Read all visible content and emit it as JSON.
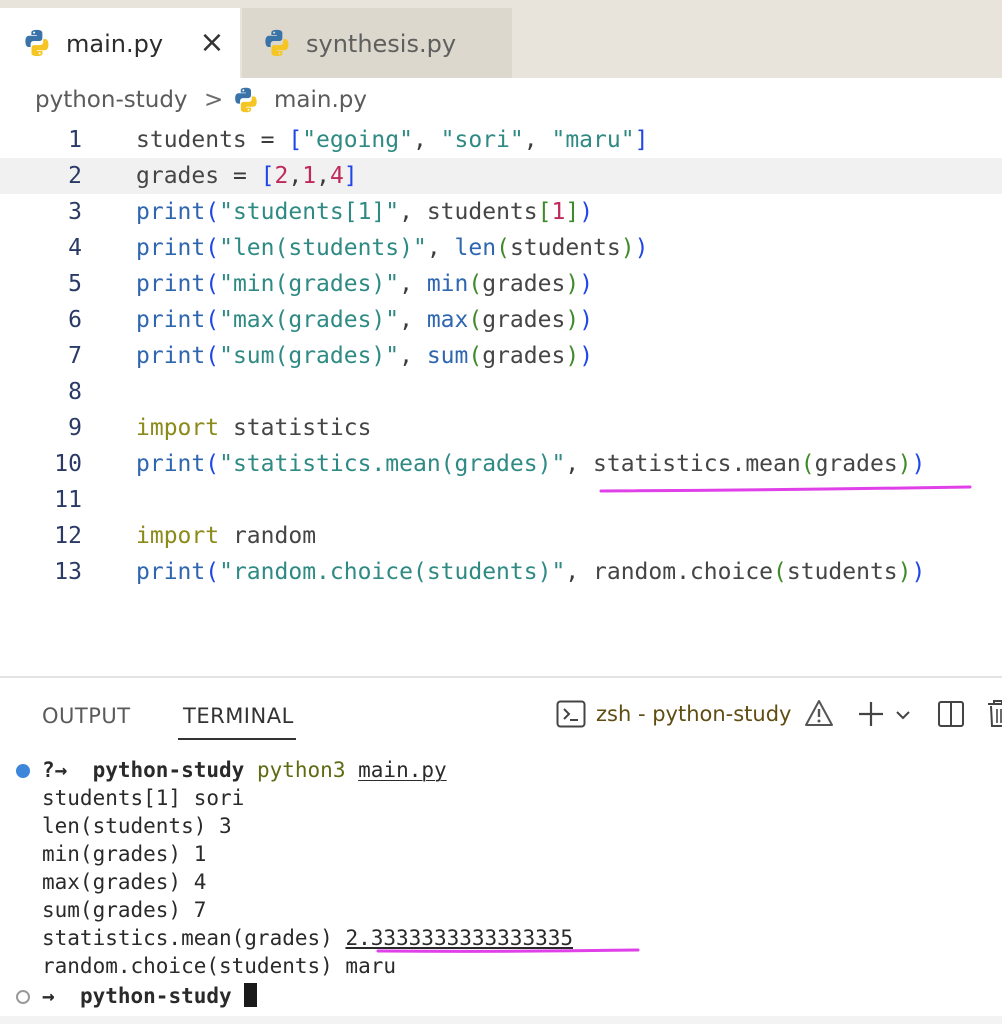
{
  "tabs": [
    {
      "label": "main.py",
      "close": "×",
      "icon": "python-icon",
      "active": true
    },
    {
      "label": "synthesis.py",
      "icon": "python-icon",
      "active": false
    }
  ],
  "breadcrumb": {
    "folder": "python-study",
    "separator": ">",
    "file": "main.py"
  },
  "editor": {
    "current_line": 2,
    "lines": [
      {
        "num": "1",
        "tokens": [
          [
            "id",
            "students"
          ],
          [
            "op",
            " = "
          ],
          [
            "p1",
            "["
          ],
          [
            "str",
            "\"egoing\""
          ],
          [
            "op",
            ", "
          ],
          [
            "str",
            "\"sori\""
          ],
          [
            "op",
            ", "
          ],
          [
            "str",
            "\"maru\""
          ],
          [
            "p1",
            "]"
          ]
        ]
      },
      {
        "num": "2",
        "tokens": [
          [
            "id",
            "grades"
          ],
          [
            "op",
            " = "
          ],
          [
            "p1",
            "["
          ],
          [
            "num",
            "2"
          ],
          [
            "op",
            ","
          ],
          [
            "num",
            "1"
          ],
          [
            "op",
            ","
          ],
          [
            "num",
            "4"
          ],
          [
            "p1",
            "]"
          ]
        ]
      },
      {
        "num": "3",
        "tokens": [
          [
            "fn",
            "print"
          ],
          [
            "p1",
            "("
          ],
          [
            "str",
            "\"students[1]\""
          ],
          [
            "op",
            ", "
          ],
          [
            "id",
            "students"
          ],
          [
            "p2",
            "["
          ],
          [
            "num",
            "1"
          ],
          [
            "p2",
            "]"
          ],
          [
            "p1",
            ")"
          ]
        ]
      },
      {
        "num": "4",
        "tokens": [
          [
            "fn",
            "print"
          ],
          [
            "p1",
            "("
          ],
          [
            "str",
            "\"len(students)\""
          ],
          [
            "op",
            ", "
          ],
          [
            "fn",
            "len"
          ],
          [
            "p2",
            "("
          ],
          [
            "id",
            "students"
          ],
          [
            "p2",
            ")"
          ],
          [
            "p1",
            ")"
          ]
        ]
      },
      {
        "num": "5",
        "tokens": [
          [
            "fn",
            "print"
          ],
          [
            "p1",
            "("
          ],
          [
            "str",
            "\"min(grades)\""
          ],
          [
            "op",
            ", "
          ],
          [
            "fn",
            "min"
          ],
          [
            "p2",
            "("
          ],
          [
            "id",
            "grades"
          ],
          [
            "p2",
            ")"
          ],
          [
            "p1",
            ")"
          ]
        ]
      },
      {
        "num": "6",
        "tokens": [
          [
            "fn",
            "print"
          ],
          [
            "p1",
            "("
          ],
          [
            "str",
            "\"max(grades)\""
          ],
          [
            "op",
            ", "
          ],
          [
            "fn",
            "max"
          ],
          [
            "p2",
            "("
          ],
          [
            "id",
            "grades"
          ],
          [
            "p2",
            ")"
          ],
          [
            "p1",
            ")"
          ]
        ]
      },
      {
        "num": "7",
        "tokens": [
          [
            "fn",
            "print"
          ],
          [
            "p1",
            "("
          ],
          [
            "str",
            "\"sum(grades)\""
          ],
          [
            "op",
            ", "
          ],
          [
            "fn",
            "sum"
          ],
          [
            "p2",
            "("
          ],
          [
            "id",
            "grades"
          ],
          [
            "p2",
            ")"
          ],
          [
            "p1",
            ")"
          ]
        ]
      },
      {
        "num": "8",
        "tokens": []
      },
      {
        "num": "9",
        "tokens": [
          [
            "kw",
            "import"
          ],
          [
            "op",
            " "
          ],
          [
            "id",
            "statistics"
          ]
        ]
      },
      {
        "num": "10",
        "tokens": [
          [
            "fn",
            "print"
          ],
          [
            "p1",
            "("
          ],
          [
            "str",
            "\"statistics.mean(grades)\""
          ],
          [
            "op",
            ", "
          ],
          [
            "id",
            "statistics.mean"
          ],
          [
            "p2",
            "("
          ],
          [
            "id",
            "grades"
          ],
          [
            "p2",
            ")"
          ],
          [
            "p1",
            ")"
          ]
        ]
      },
      {
        "num": "11",
        "tokens": []
      },
      {
        "num": "12",
        "tokens": [
          [
            "kw",
            "import"
          ],
          [
            "op",
            " "
          ],
          [
            "id",
            "random"
          ]
        ]
      },
      {
        "num": "13",
        "tokens": [
          [
            "fn",
            "print"
          ],
          [
            "p1",
            "("
          ],
          [
            "str",
            "\"random.choice(students)\""
          ],
          [
            "op",
            ", "
          ],
          [
            "id",
            "random.choice"
          ],
          [
            "p2",
            "("
          ],
          [
            "id",
            "students"
          ],
          [
            "p2",
            ")"
          ],
          [
            "p1",
            ")"
          ]
        ]
      }
    ]
  },
  "panel": {
    "tabs": {
      "output": "OUTPUT",
      "terminal": "TERMINAL"
    },
    "active_tab": "TERMINAL",
    "terminal_name": "zsh - python-study",
    "icons": [
      "terminal-icon",
      "warning-icon",
      "plus-icon",
      "chevron-down-icon",
      "split-icon",
      "trash-icon"
    ]
  },
  "terminal": {
    "prompt1": {
      "symbol": "?→",
      "dir": "python-study",
      "cmd": "python3",
      "arg": "main.py"
    },
    "output": [
      "students[1] sori",
      "len(students) 3",
      "min(grades) 1",
      "max(grades) 4",
      "sum(grades) 7"
    ],
    "mean_label": "statistics.mean(grades) ",
    "mean_value": "2.3333333333333335",
    "choice_line": "random.choice(students) maru",
    "prompt2": {
      "symbol": "→",
      "dir": "python-study"
    }
  },
  "colors": {
    "annotation": "#e040e8",
    "accent_blue": "#3e86d9"
  }
}
